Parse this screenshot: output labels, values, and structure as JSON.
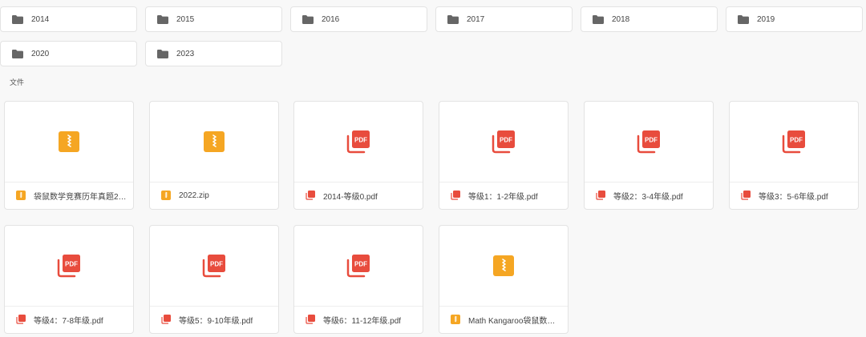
{
  "folders": [
    {
      "label": "2014"
    },
    {
      "label": "2015"
    },
    {
      "label": "2016"
    },
    {
      "label": "2017"
    },
    {
      "label": "2018"
    },
    {
      "label": "2019"
    },
    {
      "label": "2020"
    },
    {
      "label": "2023"
    }
  ],
  "files_section_label": "文件",
  "files": [
    {
      "name": "袋鼠数学竞赛历年真题2…",
      "type": "zip-icon"
    },
    {
      "name": "2022.zip",
      "type": "zip-icon"
    },
    {
      "name": "2014-等级0.pdf",
      "type": "pdf-icon"
    },
    {
      "name": "等级1：1-2年级.pdf",
      "type": "pdf-icon"
    },
    {
      "name": "等级2：3-4年级.pdf",
      "type": "pdf-icon"
    },
    {
      "name": "等级3：5-6年级.pdf",
      "type": "pdf-icon"
    },
    {
      "name": "等级4：7-8年级.pdf",
      "type": "pdf-icon"
    },
    {
      "name": "等级5：9-10年级.pdf",
      "type": "pdf-icon"
    },
    {
      "name": "等级6：11-12年级.pdf",
      "type": "pdf-icon"
    },
    {
      "name": "Math Kangaroo袋鼠数…",
      "type": "zip-icon"
    }
  ],
  "icon_text": {
    "pdf": "PDF"
  },
  "colors": {
    "folder": "#666666",
    "zip": "#f5a623",
    "pdf": "#e84c3d"
  }
}
